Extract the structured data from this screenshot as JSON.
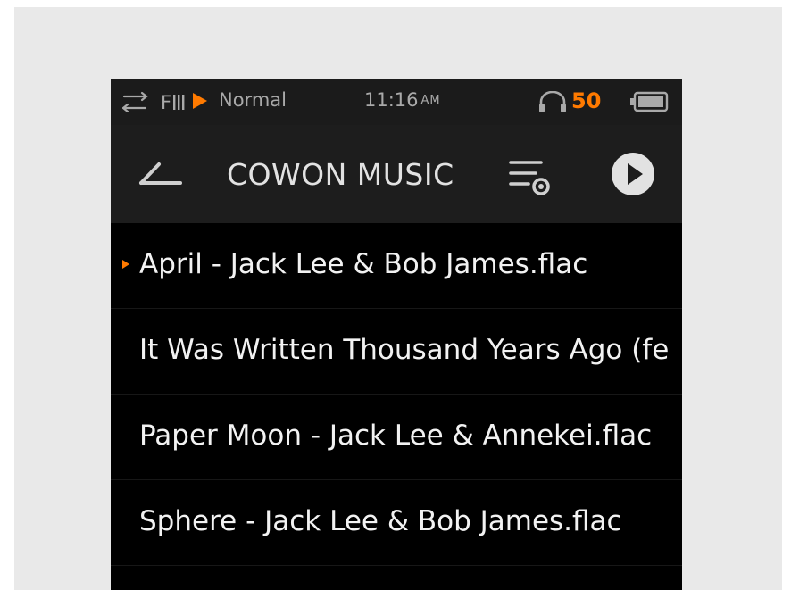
{
  "status_bar": {
    "eq_mode": "Normal",
    "time": "11:16",
    "time_suffix": "AM",
    "volume": "50",
    "battery_icon": "battery-full-icon"
  },
  "header": {
    "title": "COWON MUSIC",
    "back_icon": "back-arrow-icon",
    "settings_icon": "list-settings-icon",
    "play_icon": "play-icon"
  },
  "tracks": [
    {
      "name": "April - Jack Lee & Bob James.flac",
      "playing": true
    },
    {
      "name": "It Was Written Thousand Years Ago (fe",
      "playing": false
    },
    {
      "name": "Paper Moon - Jack Lee & Annekei.flac",
      "playing": false
    },
    {
      "name": "Sphere - Jack Lee & Bob James.flac",
      "playing": false
    }
  ],
  "colors": {
    "accent": "#ff7a00",
    "background": "#000000",
    "header": "#1d1d1d",
    "text": "#f2f2f2"
  }
}
